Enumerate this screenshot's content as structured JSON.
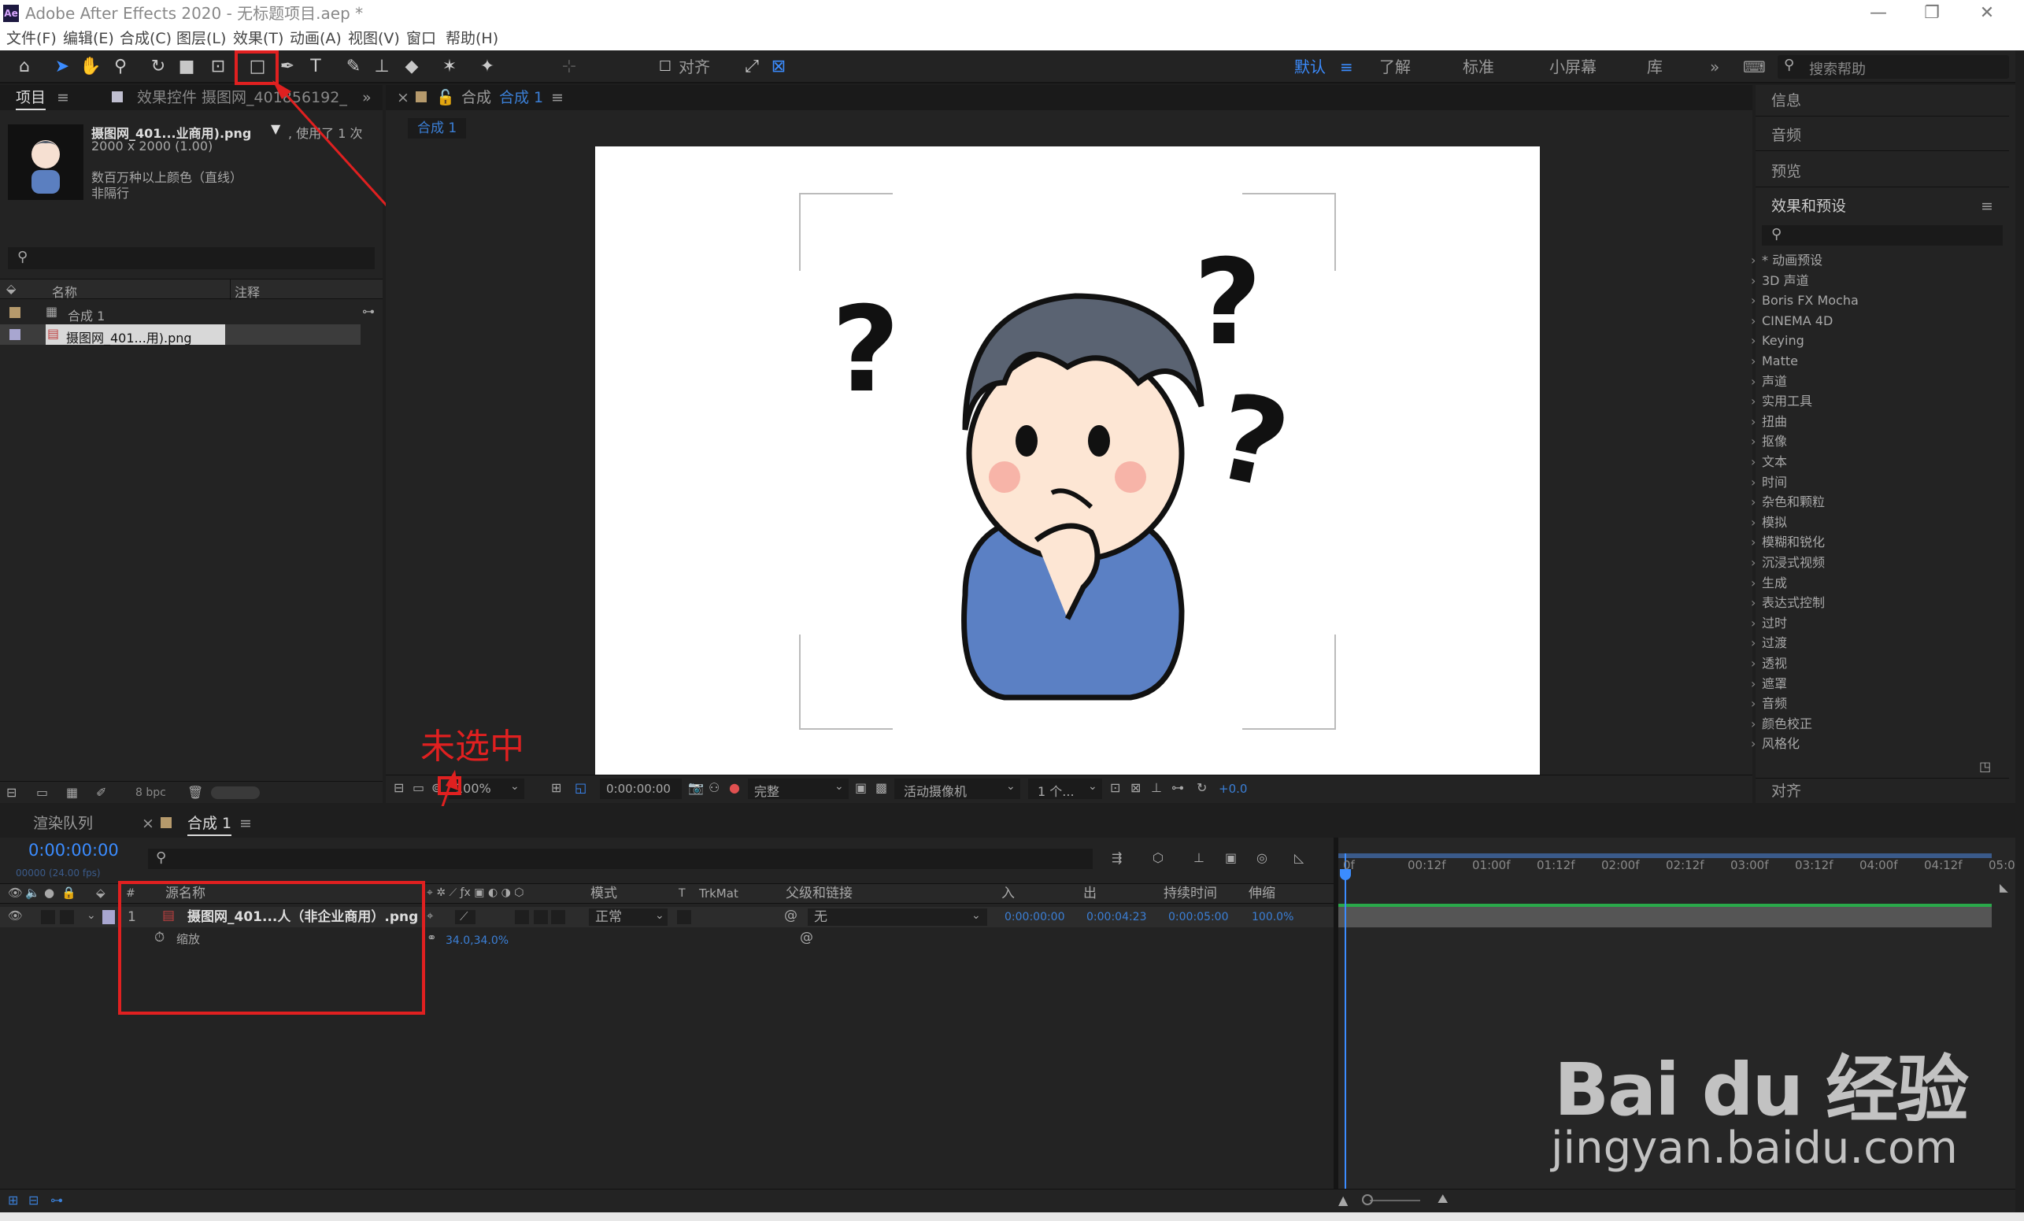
{
  "window": {
    "app_title": "Adobe After Effects 2020 - 无标题项目.aep *",
    "logo": "Ae"
  },
  "menu": [
    "文件(F)",
    "编辑(E)",
    "合成(C)",
    "图层(L)",
    "效果(T)",
    "动画(A)",
    "视图(V)",
    "窗口",
    "帮助(H)"
  ],
  "toolbar": {
    "align_label": "对齐",
    "workspaces": [
      "默认",
      "了解",
      "标准",
      "小屏幕",
      "库"
    ],
    "search_placeholder": "搜索帮助"
  },
  "project": {
    "tab_project": "项目",
    "tab_effects": "效果控件 摄图网_401856192_",
    "asset_name": "摄图网_401...业商用).png",
    "asset_used": ", 使用了 1 次",
    "asset_size": "2000 x 2000 (1.00)",
    "asset_color": "数百万种以上颜色（直线）",
    "asset_interlace": "非隔行",
    "col_name": "名称",
    "col_comment": "注释",
    "items": [
      {
        "name": "合成 1"
      },
      {
        "name": "摄图网_401...用).png"
      }
    ],
    "bpc": "8 bpc"
  },
  "viewer": {
    "tab_label": "合成",
    "tab_active": "合成 1",
    "subtab": "合成 1",
    "zoom": "100%",
    "timecode": "0:00:00:00",
    "resolution": "完整",
    "camera": "活动摄像机",
    "views": "1 个...",
    "exposure": "+0.0"
  },
  "annotation": {
    "text": "未选中"
  },
  "right_panel": {
    "info": "信息",
    "audio": "音频",
    "preview": "预览",
    "effects_title": "效果和预设",
    "align": "对齐",
    "effects": [
      "* 动画预设",
      "3D 声道",
      "Boris FX Mocha",
      "CINEMA 4D",
      "Keying",
      "Matte",
      "声道",
      "实用工具",
      "扭曲",
      "抠像",
      "文本",
      "时间",
      "杂色和颗粒",
      "模拟",
      "模糊和锐化",
      "沉浸式视频",
      "生成",
      "表达式控制",
      "过时",
      "过渡",
      "透视",
      "遮罩",
      "音频",
      "颜色校正",
      "风格化"
    ]
  },
  "timeline": {
    "tab_render": "渲染队列",
    "tab_comp": "合成 1",
    "timecode": "0:00:00:00",
    "fps": "00000 (24.00 fps)",
    "cols": {
      "num": "#",
      "source": "源名称",
      "mode": "模式",
      "t": "T",
      "trkmat": "TrkMat",
      "parent": "父级和链接",
      "in": "入",
      "out": "出",
      "duration": "持续时间",
      "stretch": "伸缩"
    },
    "layer": {
      "num": "1",
      "name": "摄图网_401...人（非企业商用）.png",
      "mode": "正常",
      "parent": "无",
      "in": "0:00:00:00",
      "out": "0:00:04:23",
      "duration": "0:00:05:00",
      "stretch": "100.0%"
    },
    "prop": {
      "name": "缩放",
      "value": "34.0,34.0%"
    },
    "ruler": [
      "0f",
      "00:12f",
      "01:00f",
      "01:12f",
      "02:00f",
      "02:12f",
      "03:00f",
      "03:12f",
      "04:00f",
      "04:12f",
      "05:0"
    ]
  },
  "watermark": {
    "brand": "Bai du 经验",
    "url": "jingyan.baidu.com"
  }
}
